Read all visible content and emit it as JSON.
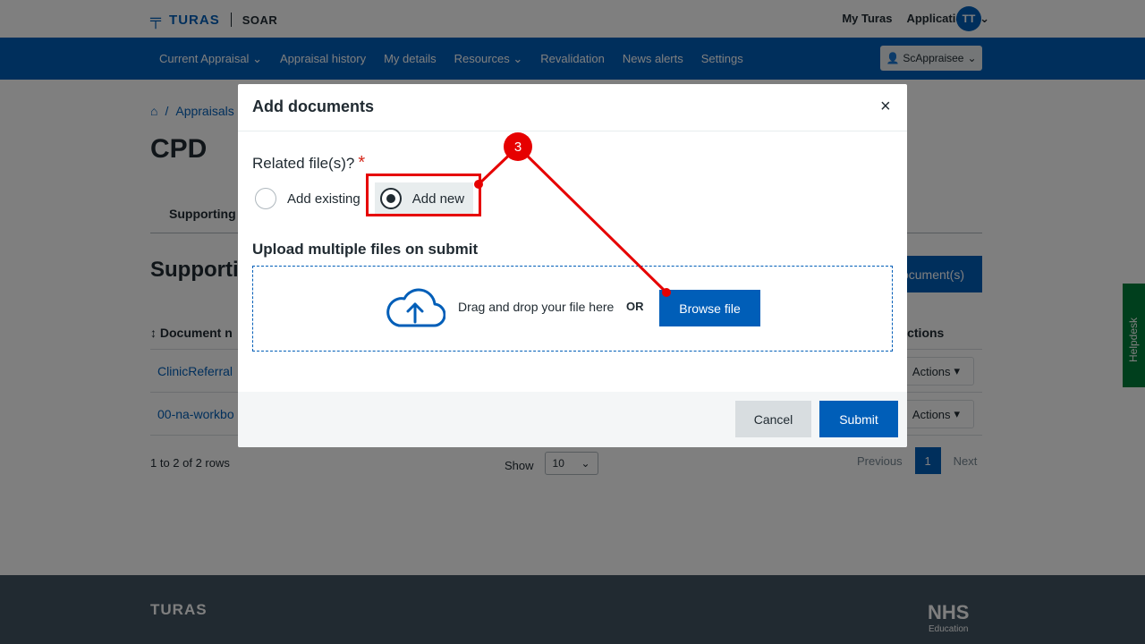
{
  "header": {
    "logo_text": "TURAS",
    "app_name": "SOAR",
    "my_turas": "My Turas",
    "applications": "Applications",
    "avatar_initials": "TT"
  },
  "nav": {
    "items": [
      "Current Appraisal",
      "Appraisal history",
      "My details",
      "Resources",
      "Revalidation",
      "News alerts",
      "Settings"
    ],
    "user": "ScAppraisee"
  },
  "page": {
    "breadcrumb": "Appraisals",
    "title": "CPD",
    "tab": "Supporting d",
    "section_title": "Supporti",
    "add_button": "Document(s)",
    "col_document": "Document n",
    "col_actions": "Actions",
    "rows": [
      "ClinicReferral",
      "00-na-workbo"
    ],
    "actions_label": "Actions",
    "rows_info": "1 to 2 of 2 rows",
    "show_label": "Show",
    "page_size": "10",
    "pager": {
      "prev": "Previous",
      "current": "1",
      "next": "Next"
    },
    "helpdesk": "Helpdesk"
  },
  "footer": {
    "logo": "TURAS",
    "nhs": "NHS",
    "nhs_sub": "Education"
  },
  "modal": {
    "title": "Add documents",
    "close_glyph": "×",
    "related_label": "Related file(s)?",
    "required_mark": "*",
    "options": {
      "existing": "Add existing",
      "new": "Add new"
    },
    "selected_option": "new",
    "upload_title": "Upload multiple files on submit",
    "drop_text": "Drag and drop your file here",
    "or_text": "OR",
    "browse_button": "Browse file",
    "cancel_button": "Cancel",
    "submit_button": "Submit"
  },
  "annotation": {
    "step": "3",
    "color": "#e60000"
  },
  "colors": {
    "primary": "#005eb8",
    "danger": "#d5281b",
    "helpdesk": "#007f3b",
    "footer": "#425563"
  }
}
